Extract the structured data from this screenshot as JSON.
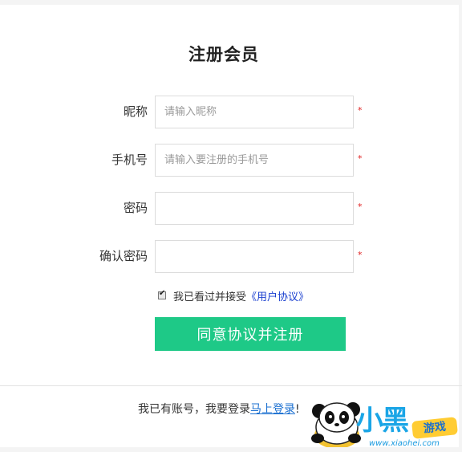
{
  "form": {
    "title": "注册会员",
    "required_mark": "*",
    "fields": [
      {
        "label": "昵称",
        "placeholder": "请输入昵称",
        "value": ""
      },
      {
        "label": "手机号",
        "placeholder": "请输入要注册的手机号",
        "value": ""
      },
      {
        "label": "密码",
        "placeholder": "",
        "value": ""
      },
      {
        "label": "确认密码",
        "placeholder": "",
        "value": ""
      }
    ],
    "agreement": {
      "checked": true,
      "text": "我已看过并接受",
      "link_text": "《用户协议》"
    },
    "submit_label": "同意协议并注册"
  },
  "footer": {
    "text": "我已有账号，我要登录",
    "link_text": "马上登录",
    "suffix": "!"
  },
  "watermark": {
    "brand_text": "小黑",
    "badge_text": "游戏",
    "url_text": "www.xiaohei.com"
  },
  "colors": {
    "accent_green": "#1ec987",
    "link_blue": "#1a3fcf",
    "required_red": "#e02020"
  }
}
